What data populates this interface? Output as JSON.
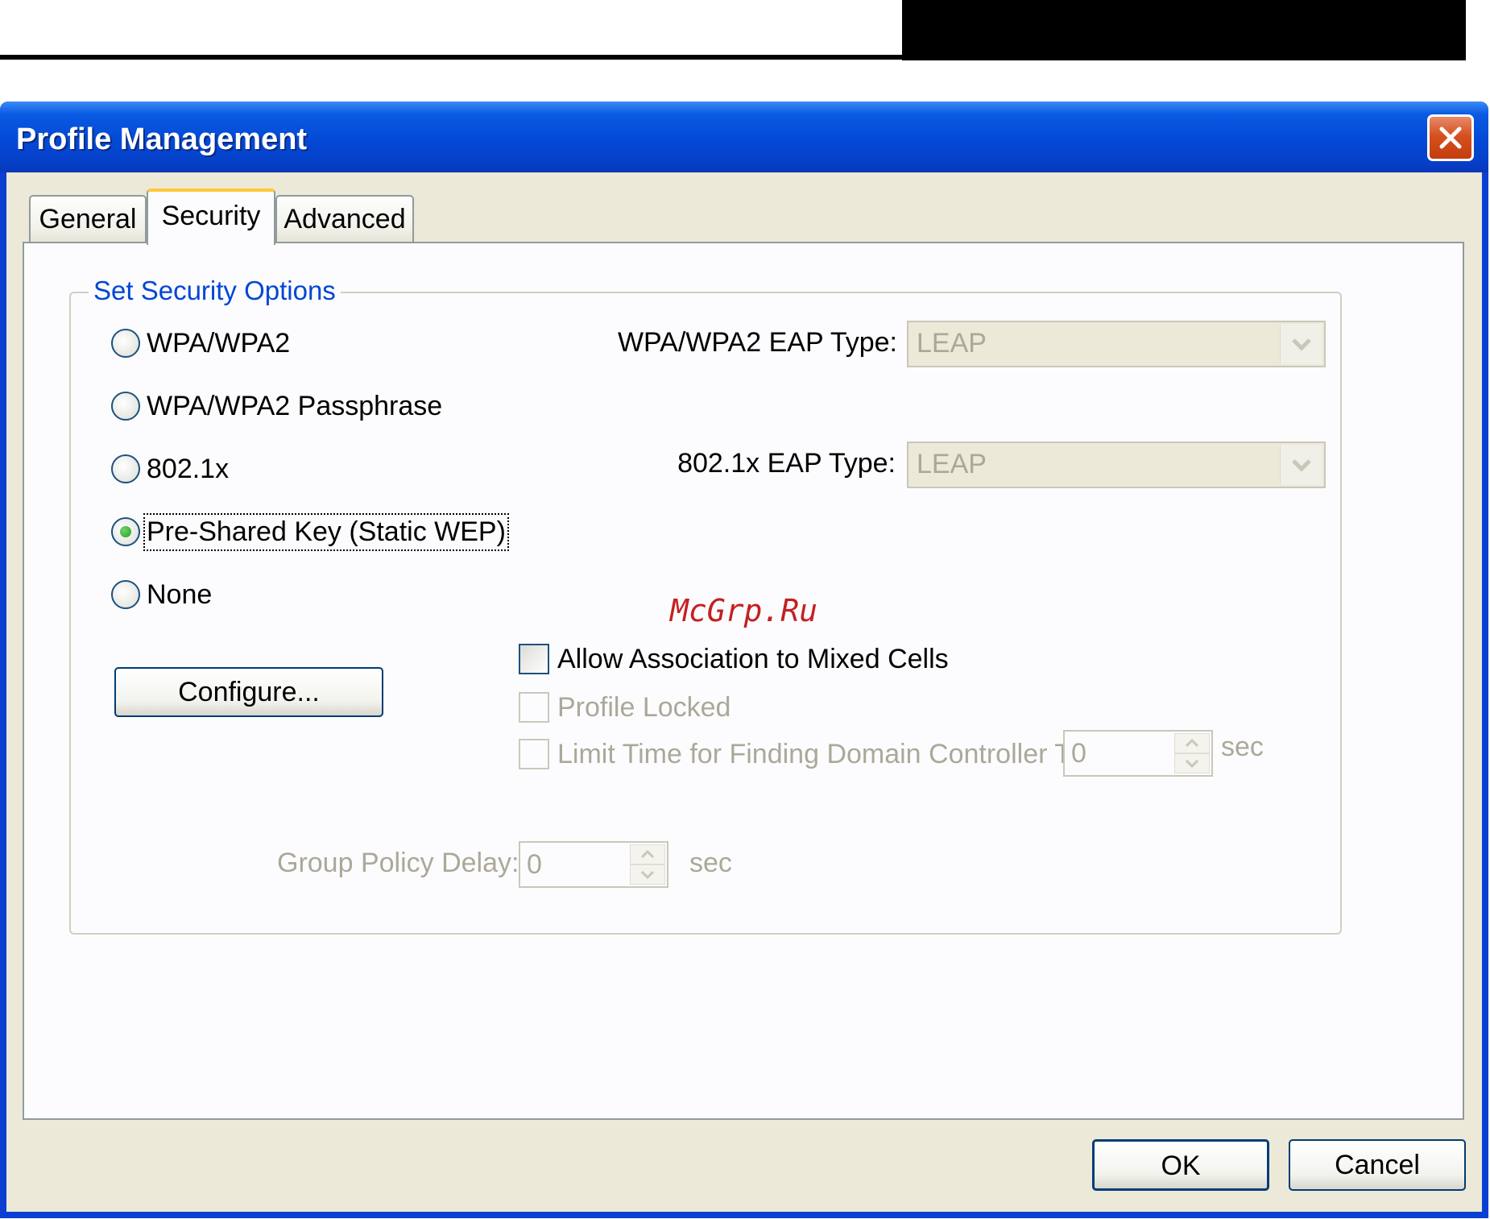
{
  "window": {
    "title": "Profile Management",
    "close_icon": "close-icon"
  },
  "tabs": [
    {
      "label": "General",
      "active": false
    },
    {
      "label": "Security",
      "active": true
    },
    {
      "label": "Advanced",
      "active": false
    }
  ],
  "group": {
    "legend": "Set Security Options"
  },
  "radios": [
    {
      "label": "WPA/WPA2",
      "checked": false
    },
    {
      "label": "WPA/WPA2 Passphrase",
      "checked": false
    },
    {
      "label": "802.1x",
      "checked": false
    },
    {
      "label": "Pre-Shared Key (Static WEP)",
      "checked": true
    },
    {
      "label": "None",
      "checked": false
    }
  ],
  "eap": {
    "wpa_label": "WPA/WPA2 EAP Type:",
    "wpa_value": "LEAP",
    "dot1x_label": "802.1x EAP Type:",
    "dot1x_value": "LEAP"
  },
  "configure_label": "Configure...",
  "checkboxes": [
    {
      "label": "Allow Association to Mixed Cells",
      "checked": false,
      "enabled": true
    },
    {
      "label": "Profile Locked",
      "checked": false,
      "enabled": false
    },
    {
      "label": "Limit Time for Finding Domain Controller To:",
      "checked": false,
      "enabled": false
    }
  ],
  "limit_time": {
    "value": "0",
    "unit": "sec"
  },
  "group_policy": {
    "label": "Group Policy Delay:",
    "value": "0",
    "unit": "sec"
  },
  "buttons": {
    "ok": "OK",
    "cancel": "Cancel"
  },
  "watermark": "McGrp.Ru",
  "colors": {
    "titlebar": "#0349d6",
    "legend": "#0046d5",
    "face": "#ece9d8",
    "watermark": "#c42020"
  }
}
